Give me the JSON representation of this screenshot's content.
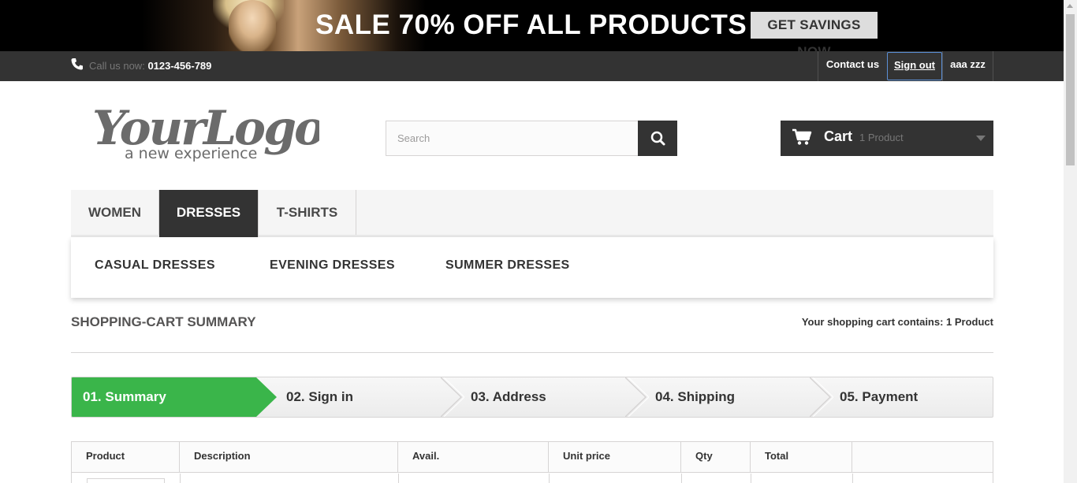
{
  "promo": {
    "headline": "SALE 70% OFF ALL PRODUCTS",
    "button_label": "GET SAVINGS NOW"
  },
  "topbar": {
    "call_prefix": "Call us now:",
    "phone": "0123-456-789",
    "contact_label": "Contact us",
    "signout_label": "Sign out",
    "user_name": "aaa zzz"
  },
  "header": {
    "logo_main": "YourLogo",
    "logo_tagline": "a new experience",
    "search_placeholder": "Search",
    "cart_label": "Cart",
    "cart_count": "1 Product"
  },
  "menu": {
    "items": [
      {
        "label": "WOMEN"
      },
      {
        "label": "DRESSES"
      },
      {
        "label": "T-SHIRTS"
      }
    ],
    "active": "DRESSES",
    "submenu": [
      {
        "label": "CASUAL DRESSES"
      },
      {
        "label": "EVENING DRESSES"
      },
      {
        "label": "SUMMER DRESSES"
      }
    ]
  },
  "cart_page": {
    "heading": "SHOPPING-CART SUMMARY",
    "contains_text": "Your shopping cart contains: 1 Product",
    "steps": [
      {
        "label": "01. Summary"
      },
      {
        "label": "02. Sign in"
      },
      {
        "label": "03. Address"
      },
      {
        "label": "04. Shipping"
      },
      {
        "label": "05. Payment"
      }
    ],
    "active_step_color": "#3ab54a",
    "table_headers": [
      "Product",
      "Description",
      "Avail.",
      "Unit price",
      "Qty",
      "Total"
    ]
  }
}
